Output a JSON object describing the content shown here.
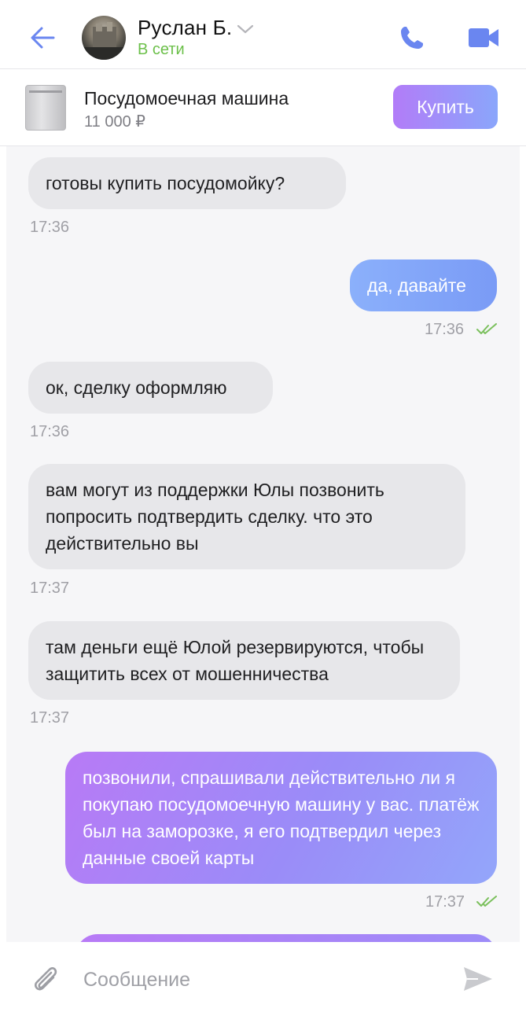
{
  "header": {
    "contact_name": "Руслан Б.",
    "status": "В сети"
  },
  "product": {
    "title": "Посудомоечная машина",
    "price": "11 000 ₽",
    "buy_label": "Купить"
  },
  "messages": [
    {
      "side": "in",
      "text": "готовы купить посудомойку?",
      "time": "17:36"
    },
    {
      "side": "out",
      "text": "да, давайте",
      "time": "17:36"
    },
    {
      "side": "in",
      "text": "ок, сделку оформляю",
      "time": "17:36"
    },
    {
      "side": "in",
      "text": "вам могут из поддержки Юлы позвонить попросить подтвердить сделку. что это действительно вы",
      "time": "17:37"
    },
    {
      "side": "in",
      "text": "там деньги ещё Юлой резервируются, чтобы защитить всех от мошенничества",
      "time": "17:37"
    },
    {
      "side": "out",
      "text": "позвонили, спрашивали действительно ли я покупаю посудомоечную машину у вас. платёж был на заморозке, я его подтвердил через данные своей карты",
      "time": "17:37"
    }
  ],
  "composer": {
    "placeholder": "Сообщение"
  },
  "colors": {
    "online": "#6cc04a",
    "accent_blue": "#6a86f0",
    "outgoing_gradient_start": "#b47df7",
    "outgoing_gradient_end": "#8ea7fa",
    "read_ticks": "#7bc05d"
  }
}
